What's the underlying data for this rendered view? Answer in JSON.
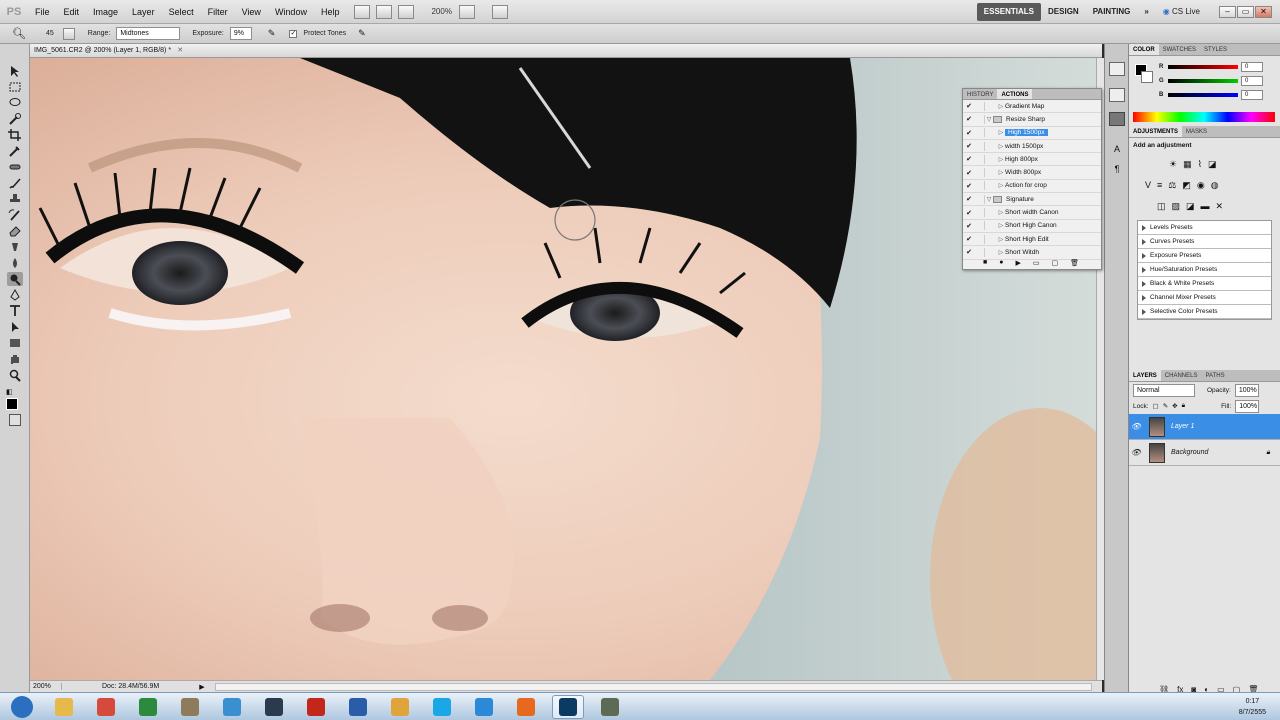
{
  "menubar": {
    "logo": "PS",
    "items": [
      "File",
      "Edit",
      "Image",
      "Layer",
      "Select",
      "Filter",
      "View",
      "Window",
      "Help"
    ],
    "zoom": "200%",
    "workspaces": [
      "ESSENTIALS",
      "DESIGN",
      "PAINTING"
    ],
    "more": "»",
    "cslive": "CS Live"
  },
  "options": {
    "brush_size": "45",
    "range_label": "Range:",
    "range_value": "Midtones",
    "exposure_label": "Exposure:",
    "exposure_value": "9%",
    "protect_tones": "Protect Tones"
  },
  "document": {
    "tab_title": "IMG_5061.CR2 @ 200% (Layer 1, RGB/8) *",
    "zoom": "200%",
    "doc_info": "Doc: 28.4M/56.9M"
  },
  "actions_panel": {
    "tabs": [
      "HISTORY",
      "ACTIONS"
    ],
    "rows": [
      {
        "label": "Gradient Map",
        "kind": "action"
      },
      {
        "label": "Resize Sharp",
        "kind": "set"
      },
      {
        "label": "High 1500px",
        "kind": "action",
        "selected": true
      },
      {
        "label": "width 1500px",
        "kind": "action"
      },
      {
        "label": "High 800px",
        "kind": "action"
      },
      {
        "label": "Width 800px",
        "kind": "action"
      },
      {
        "label": "Action for crop",
        "kind": "action"
      },
      {
        "label": "Signature",
        "kind": "set"
      },
      {
        "label": "Short width Canon",
        "kind": "action"
      },
      {
        "label": "Short High Canon",
        "kind": "action"
      },
      {
        "label": "Short High Edit",
        "kind": "action"
      },
      {
        "label": "Short Witdh",
        "kind": "action"
      }
    ]
  },
  "color_panel": {
    "tabs": [
      "COLOR",
      "SWATCHES",
      "STYLES"
    ],
    "channels": [
      {
        "name": "R",
        "value": "0"
      },
      {
        "name": "G",
        "value": "0"
      },
      {
        "name": "B",
        "value": "0"
      }
    ]
  },
  "adjustments_panel": {
    "tabs": [
      "ADJUSTMENTS",
      "MASKS"
    ],
    "heading": "Add an adjustment",
    "presets": [
      "Levels Presets",
      "Curves Presets",
      "Exposure Presets",
      "Hue/Saturation Presets",
      "Black & White Presets",
      "Channel Mixer Presets",
      "Selective Color Presets"
    ]
  },
  "layers_panel": {
    "tabs": [
      "LAYERS",
      "CHANNELS",
      "PATHS"
    ],
    "blend_mode": "Normal",
    "opacity_label": "Opacity:",
    "opacity": "100%",
    "lock_label": "Lock:",
    "fill_label": "Fill:",
    "fill": "100%",
    "layers": [
      {
        "name": "Layer 1",
        "selected": true
      },
      {
        "name": "Background",
        "selected": false
      }
    ]
  },
  "taskbar": {
    "time": "0:17",
    "date": "8/7/2555",
    "apps": [
      "start",
      "explorer",
      "chrome",
      "excel",
      "gimp",
      "maps",
      "steam",
      "filezilla",
      "word",
      "sketch",
      "skype",
      "ie",
      "firefox",
      "photoshop",
      "misc"
    ]
  },
  "colors": {
    "accent": "#3b8ee6",
    "workspace_active": "#5a5a5a"
  }
}
